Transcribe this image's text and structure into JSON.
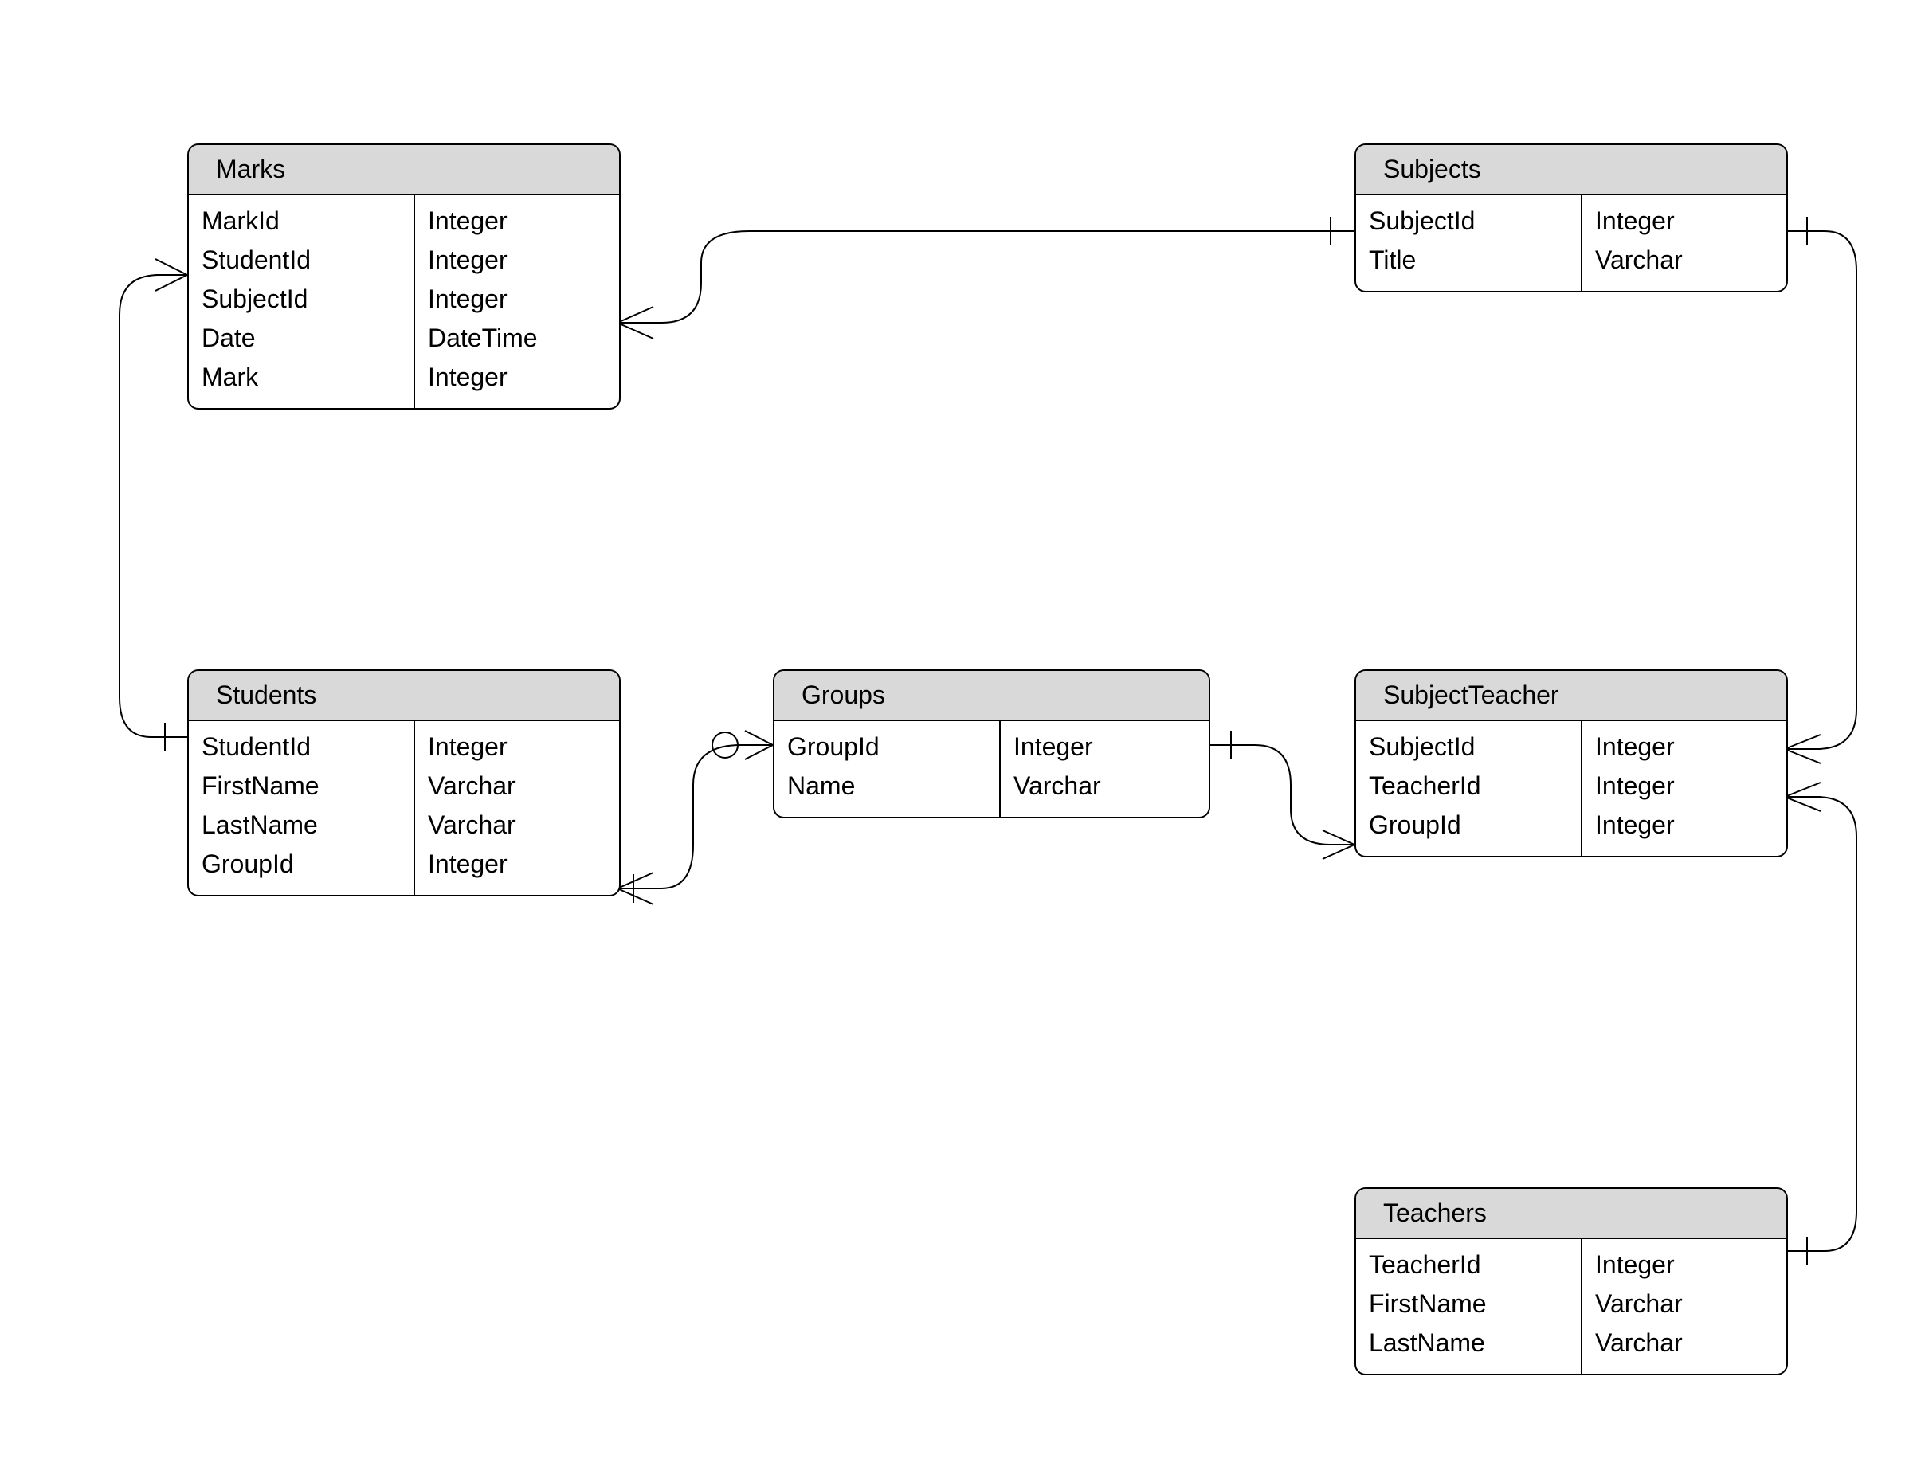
{
  "diagram": {
    "type": "entity-relationship",
    "entities": {
      "marks": {
        "title": "Marks",
        "cols": [
          {
            "name": "MarkId",
            "type": "Integer"
          },
          {
            "name": "StudentId",
            "type": "Integer"
          },
          {
            "name": "SubjectId",
            "type": "Integer"
          },
          {
            "name": "Date",
            "type": "DateTime"
          },
          {
            "name": "Mark",
            "type": "Integer"
          }
        ]
      },
      "subjects": {
        "title": "Subjects",
        "cols": [
          {
            "name": "SubjectId",
            "type": "Integer"
          },
          {
            "name": "Title",
            "type": "Varchar"
          }
        ]
      },
      "students": {
        "title": "Students",
        "cols": [
          {
            "name": "StudentId",
            "type": "Integer"
          },
          {
            "name": "FirstName",
            "type": "Varchar"
          },
          {
            "name": "LastName",
            "type": "Varchar"
          },
          {
            "name": "GroupId",
            "type": "Integer"
          }
        ]
      },
      "groups": {
        "title": "Groups",
        "cols": [
          {
            "name": "GroupId",
            "type": "Integer"
          },
          {
            "name": "Name",
            "type": "Varchar"
          }
        ]
      },
      "subjectteacher": {
        "title": "SubjectTeacher",
        "cols": [
          {
            "name": "SubjectId",
            "type": "Integer"
          },
          {
            "name": "TeacherId",
            "type": "Integer"
          },
          {
            "name": "GroupId",
            "type": "Integer"
          }
        ]
      },
      "teachers": {
        "title": "Teachers",
        "cols": [
          {
            "name": "TeacherId",
            "type": "Integer"
          },
          {
            "name": "FirstName",
            "type": "Varchar"
          },
          {
            "name": "LastName",
            "type": "Varchar"
          }
        ]
      }
    },
    "relationships": [
      {
        "from": "Marks",
        "to": "Subjects",
        "fromCard": "many",
        "toCard": "one"
      },
      {
        "from": "Students",
        "to": "Marks",
        "fromCard": "one",
        "toCard": "many"
      },
      {
        "from": "Students",
        "to": "Groups",
        "fromCard": "one-or-more",
        "toCard": "zero-or-one"
      },
      {
        "from": "Groups",
        "to": "SubjectTeacher",
        "fromCard": "one",
        "toCard": "many"
      },
      {
        "from": "Subjects",
        "to": "SubjectTeacher",
        "fromCard": "one",
        "toCard": "many"
      },
      {
        "from": "Teachers",
        "to": "SubjectTeacher",
        "fromCard": "one",
        "toCard": "many"
      }
    ]
  }
}
